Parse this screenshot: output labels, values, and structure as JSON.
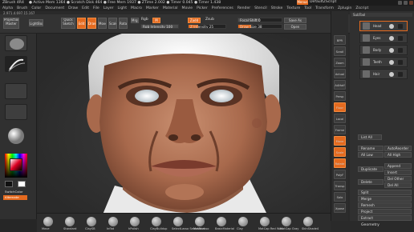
{
  "titlebar": {
    "app": "ZBrush 4R4",
    "status": "● Active Mem 1364 ● Scratch Disk 464 ● Free Mem 1937 ● ZTime 2.002 ● Timer 0.045 ● Timer 1.438",
    "menu_label": "Menus",
    "script_label": "DefaultZScript"
  },
  "menubar": {
    "items": [
      "Alpha",
      "Brush",
      "Color",
      "Document",
      "Draw",
      "Edit",
      "File",
      "Layer",
      "Light",
      "Macro",
      "Marker",
      "Material",
      "Movie",
      "Picker",
      "Preferences",
      "Render",
      "Stencil",
      "Stroke",
      "Texture",
      "Tool",
      "Transform",
      "Zplugin",
      "Zscript"
    ]
  },
  "coords": "2.971,4.697,15.167",
  "shelf": {
    "projection_master": "Projection Master",
    "lightbox": "LightBox",
    "quick_sketch": "Quick Sketch",
    "edit": "Edit",
    "draw": "Draw",
    "move": "Move",
    "scale": "Scale",
    "rotate": "Rotate",
    "mrgb": "Mrgb",
    "rgb": "Rgb",
    "m": "M",
    "zadd": "Zadd",
    "zsub": "Zsub",
    "zcut": "Zcut",
    "rgb_intensity": "Rgb Intensity 100",
    "z_intensity": "Z Intensity 25",
    "focal_shift": "Focal Shift 0",
    "draw_size": "Draw Size 38",
    "save_as": "Save As",
    "open": "Open"
  },
  "left": {
    "alternate": "Alternate",
    "switchcolor": "SwitchColor",
    "gradient": "Gradient"
  },
  "righttool": {
    "buttons": [
      "BPR",
      "Scroll",
      "Zoom",
      "Actual",
      "AAHalf",
      "Persp",
      "Floor",
      "Local",
      "Frame",
      "Move",
      "Scale",
      "Rotate",
      "PolyF",
      "Transp",
      "Solo",
      "Xpose"
    ]
  },
  "subtool": {
    "header": "SubTool",
    "items": [
      "Head",
      "Eyes",
      "Body",
      "Teeth",
      "Hair"
    ],
    "list_all": "List All",
    "rename": "Rename",
    "autoreorder": "AutoReorder",
    "all_low": "All Low",
    "all_high": "All High",
    "duplicate": "Duplicate",
    "append": "Append",
    "insert": "Insert",
    "delete": "Delete",
    "del_other": "Del Other",
    "del_all": "Del All",
    "split": "Split",
    "merge": "Merge",
    "remesh": "Remesh",
    "project": "Project",
    "extract": "Extract",
    "geometry": "Geometry"
  },
  "bottomtray": {
    "items": [
      "Move",
      "Standard",
      "ClaySB",
      "Inflat",
      "hPolish",
      "ClayBuildup",
      "SelectLasso SelectRect",
      "MaskLasso",
      "BasicMaterial",
      "Clay",
      "MatCap Red Wax",
      "MatCap Gray",
      "SkinShade4"
    ]
  },
  "colors": {
    "accent": "#e46a1f",
    "bg": "#2a2a2a"
  }
}
